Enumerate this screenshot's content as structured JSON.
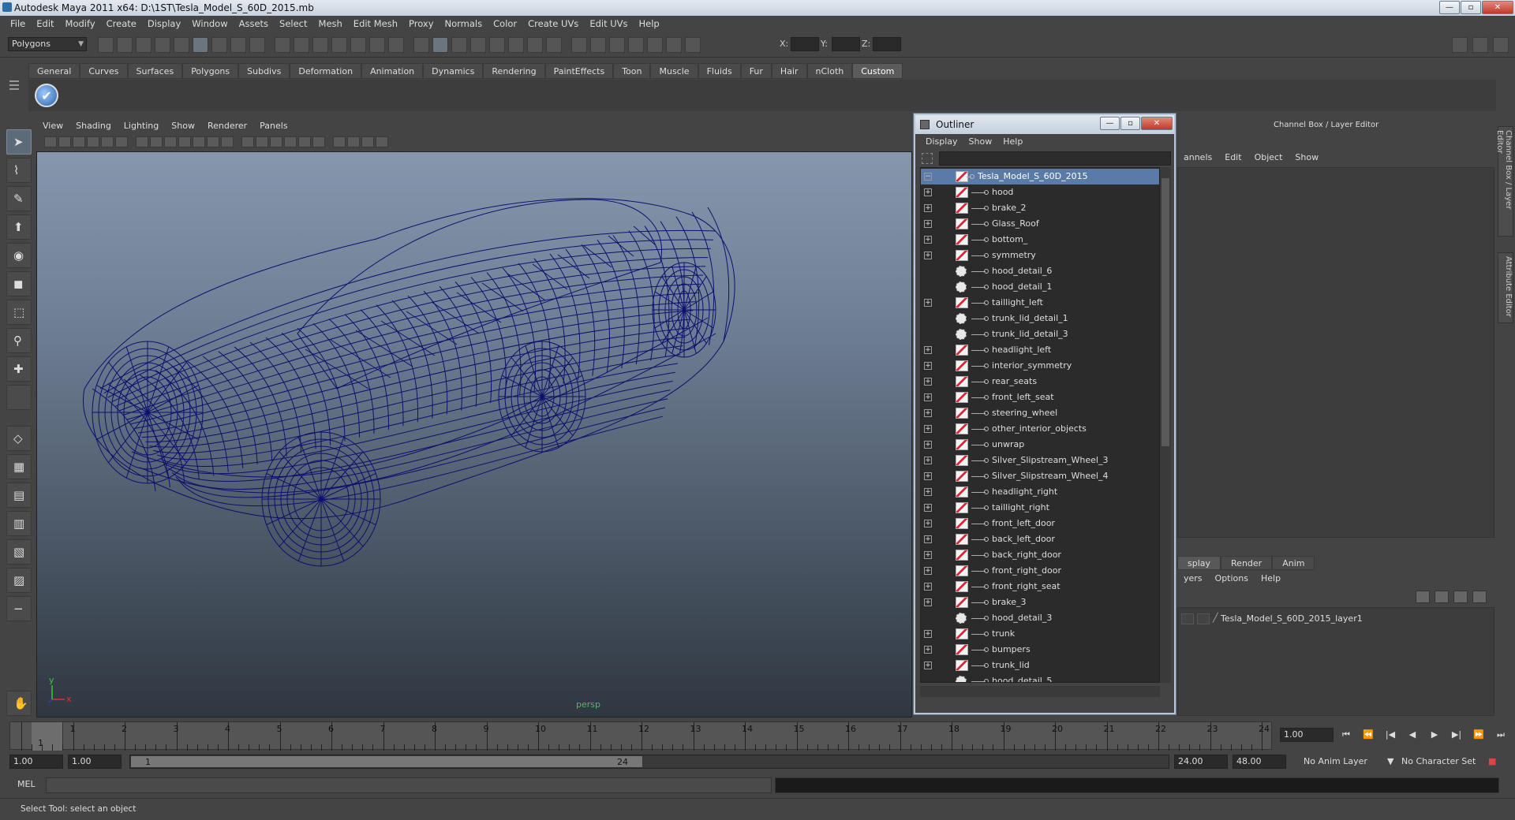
{
  "window": {
    "title": "Autodesk Maya 2011 x64: D:\\1ST\\Tesla_Model_S_60D_2015.mb"
  },
  "menubar": [
    "File",
    "Edit",
    "Modify",
    "Create",
    "Display",
    "Window",
    "Assets",
    "Select",
    "Mesh",
    "Edit Mesh",
    "Proxy",
    "Normals",
    "Color",
    "Create UVs",
    "Edit UVs",
    "Help"
  ],
  "statusline": {
    "mode": "Polygons",
    "x_label": "X:",
    "y_label": "Y:",
    "z_label": "Z:"
  },
  "shelf": {
    "tabs": [
      "General",
      "Curves",
      "Surfaces",
      "Polygons",
      "Subdivs",
      "Deformation",
      "Animation",
      "Dynamics",
      "Rendering",
      "PaintEffects",
      "Toon",
      "Muscle",
      "Fluids",
      "Fur",
      "Hair",
      "nCloth",
      "Custom"
    ],
    "active_tab": "Custom"
  },
  "viewport": {
    "menu": [
      "View",
      "Shading",
      "Lighting",
      "Show",
      "Renderer",
      "Panels"
    ],
    "camera_label": "persp",
    "axis_x": "x",
    "axis_y": "y",
    "wire_color": "#0a0a6e"
  },
  "outliner": {
    "title": "Outliner",
    "menu": [
      "Display",
      "Show",
      "Help"
    ],
    "items": [
      {
        "name": "Tesla_Model_S_60D_2015",
        "exp": "−",
        "type": "mesh",
        "root": true,
        "selected": true
      },
      {
        "name": "hood",
        "exp": "+",
        "type": "mesh"
      },
      {
        "name": "brake_2",
        "exp": "+",
        "type": "mesh"
      },
      {
        "name": "Glass_Roof",
        "exp": "+",
        "type": "mesh"
      },
      {
        "name": "bottom_",
        "exp": "+",
        "type": "mesh"
      },
      {
        "name": "symmetry",
        "exp": "+",
        "type": "mesh"
      },
      {
        "name": "hood_detail_6",
        "exp": "",
        "type": "group"
      },
      {
        "name": "hood_detail_1",
        "exp": "",
        "type": "group"
      },
      {
        "name": "taillight_left",
        "exp": "+",
        "type": "mesh"
      },
      {
        "name": "trunk_lid_detail_1",
        "exp": "",
        "type": "group"
      },
      {
        "name": "trunk_lid_detail_3",
        "exp": "",
        "type": "group"
      },
      {
        "name": "headlight_left",
        "exp": "+",
        "type": "mesh"
      },
      {
        "name": "interior_symmetry",
        "exp": "+",
        "type": "mesh"
      },
      {
        "name": "rear_seats",
        "exp": "+",
        "type": "mesh"
      },
      {
        "name": "front_left_seat",
        "exp": "+",
        "type": "mesh"
      },
      {
        "name": "steering_wheel",
        "exp": "+",
        "type": "mesh"
      },
      {
        "name": "other_interior_objects",
        "exp": "+",
        "type": "mesh"
      },
      {
        "name": "unwrap",
        "exp": "+",
        "type": "mesh"
      },
      {
        "name": "Silver_Slipstream_Wheel_3",
        "exp": "+",
        "type": "mesh"
      },
      {
        "name": "Silver_Slipstream_Wheel_4",
        "exp": "+",
        "type": "mesh"
      },
      {
        "name": "headlight_right",
        "exp": "+",
        "type": "mesh"
      },
      {
        "name": "taillight_right",
        "exp": "+",
        "type": "mesh"
      },
      {
        "name": "front_left_door",
        "exp": "+",
        "type": "mesh"
      },
      {
        "name": "back_left_door",
        "exp": "+",
        "type": "mesh"
      },
      {
        "name": "back_right_door",
        "exp": "+",
        "type": "mesh"
      },
      {
        "name": "front_right_door",
        "exp": "+",
        "type": "mesh"
      },
      {
        "name": "front_right_seat",
        "exp": "+",
        "type": "mesh"
      },
      {
        "name": "brake_3",
        "exp": "+",
        "type": "mesh"
      },
      {
        "name": "hood_detail_3",
        "exp": "",
        "type": "group"
      },
      {
        "name": "trunk",
        "exp": "+",
        "type": "mesh"
      },
      {
        "name": "bumpers",
        "exp": "+",
        "type": "mesh"
      },
      {
        "name": "trunk_lid",
        "exp": "+",
        "type": "mesh"
      },
      {
        "name": "hood_detail_5",
        "exp": "",
        "type": "group"
      }
    ]
  },
  "channel_box": {
    "title": "Channel Box / Layer Editor",
    "menu": [
      "annels",
      "Edit",
      "Object",
      "Show"
    ],
    "side_tabs": [
      "Channel Box / Layer Editor",
      "Attribute Editor"
    ]
  },
  "layer_editor": {
    "tabs": [
      "splay",
      "Render",
      "Anim"
    ],
    "menu": [
      "yers",
      "Options",
      "Help"
    ],
    "layers": [
      "Tesla_Model_S_60D_2015_layer1"
    ]
  },
  "timeline": {
    "ticks": [
      "1",
      "2",
      "3",
      "4",
      "5",
      "6",
      "7",
      "8",
      "9",
      "10",
      "11",
      "12",
      "13",
      "14",
      "15",
      "16",
      "17",
      "18",
      "19",
      "20",
      "21",
      "22",
      "23",
      "24"
    ],
    "current_frame": "1",
    "current_time_field": "1.00",
    "playback": [
      "⏮",
      "⏪",
      "|◀",
      "◀",
      "▶",
      "▶|",
      "⏩",
      "⏭"
    ]
  },
  "range": {
    "start_field": "1.00",
    "anim_start_field": "1.00",
    "range_start": "1",
    "range_end": "24",
    "end_field": "24.00",
    "anim_end_field": "48.00",
    "anim_layer": "No Anim Layer",
    "char_set": "No Character Set"
  },
  "command_line": {
    "label": "MEL"
  },
  "help_line": {
    "text": "Select Tool: select an object"
  }
}
